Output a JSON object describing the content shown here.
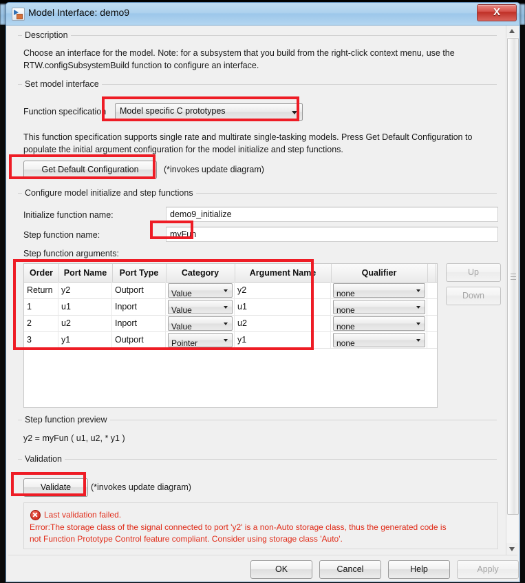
{
  "window": {
    "title": "Model Interface: demo9",
    "icon": "simulink-model-icon",
    "close_label": "X"
  },
  "description": {
    "group_label": "Description",
    "line1": "Choose an interface for the model. Note: for a subsystem that you build from the right-click context menu, use the",
    "line2": "RTW.configSubsystemBuild function to configure an interface."
  },
  "set_model_interface": {
    "group_label": "Set model interface",
    "function_spec_label": "Function specification",
    "function_spec_value": "Model specific C prototypes",
    "help_line1": "This function specification supports single rate and multirate single-tasking models.  Press Get Default Configuration to",
    "help_line2": "populate the initial argument configuration for the model initialize and step functions.",
    "get_default_button": "Get Default Configuration",
    "get_default_note": "(*invokes update diagram)"
  },
  "configure": {
    "group_label": "Configure model initialize and step functions",
    "initialize_label": "Initialize function name:",
    "initialize_value": "demo9_initialize",
    "step_name_label": "Step function name:",
    "step_name_value": "myFun",
    "step_args_label": "Step function arguments:",
    "columns": [
      "Order",
      "Port Name",
      "Port Type",
      "Category",
      "Argument Name",
      "Qualifier"
    ],
    "rows": [
      {
        "order": "Return",
        "port_name": "y2",
        "port_type": "Outport",
        "category": "Value",
        "argument_name": "y2",
        "qualifier": "none"
      },
      {
        "order": "1",
        "port_name": "u1",
        "port_type": "Inport",
        "category": "Value",
        "argument_name": "u1",
        "qualifier": "none"
      },
      {
        "order": "2",
        "port_name": "u2",
        "port_type": "Inport",
        "category": "Value",
        "argument_name": "u2",
        "qualifier": "none"
      },
      {
        "order": "3",
        "port_name": "y1",
        "port_type": "Outport",
        "category": "Pointer",
        "argument_name": "y1",
        "qualifier": "none"
      }
    ],
    "up_button": "Up",
    "down_button": "Down"
  },
  "preview": {
    "group_label": "Step function preview",
    "text": "y2 = myFun ( u1, u2, * y1 )"
  },
  "validation": {
    "group_label": "Validation",
    "validate_button": "Validate",
    "validate_note": "(*invokes update diagram)",
    "status_title": "Last validation failed.",
    "error_line1": "Error:The storage class of the signal connected to port 'y2' is a non-Auto storage class, thus the generated code is",
    "error_line2": "not Function Prototype Control feature compliant. Consider using storage class 'Auto'."
  },
  "footer": {
    "ok": "OK",
    "cancel": "Cancel",
    "help": "Help",
    "apply": "Apply"
  },
  "colors": {
    "annotation": "#ee1c25",
    "error_text": "#e02b18",
    "titlebar": "#aed2ee",
    "close_button": "#bf2f26"
  }
}
